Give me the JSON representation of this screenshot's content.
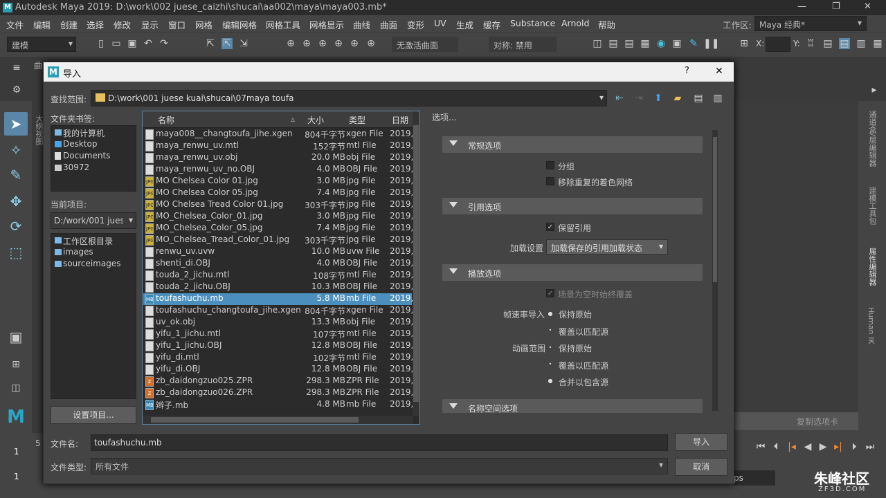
{
  "app": {
    "title": "Autodesk Maya 2019: D:\\work\\002 juese_caizhi\\shucai\\aa002\\maya\\maya003.mb*",
    "logo": "M",
    "menus": [
      "文件",
      "编辑",
      "创建",
      "选择",
      "修改",
      "显示",
      "窗口",
      "网格",
      "编辑网格",
      "网格工具",
      "网格显示",
      "曲线",
      "曲面",
      "变形",
      "UV",
      "生成",
      "缓存",
      "Substance",
      "Arnold",
      "帮助"
    ],
    "workspace_label": "工作区:",
    "workspace_value": "Maya 经典*",
    "mode_value": "建模",
    "live_surface": "无激活曲面",
    "symmetry": "对称: 禁用",
    "x_label": "X:",
    "y_label": "Y:",
    "shelf_tab": "曲",
    "right_tabs": [
      "通道盒/层编辑器",
      "建模工具包",
      "属性编辑器",
      "Human IK"
    ],
    "left_vertical": "大纲视图",
    "frame_start": "1",
    "frame_start2": "1",
    "frame_field": "5",
    "copy_tab": "复制选项卡",
    "fps_text": "ps",
    "watermark": "朱峰社区",
    "watermark_url": "ZF3D.COM"
  },
  "dialog": {
    "title": "导入",
    "help": "?",
    "close": "✕",
    "lookin_label": "查找范围:",
    "lookin_path": "D:\\work\\001 juese kuai\\shucai\\07maya toufa",
    "bookmarks_label": "文件夹书签:",
    "bookmarks": [
      "我的计算机",
      "Desktop",
      "Documents",
      "30972"
    ],
    "current_project_label": "当前项目:",
    "current_project": "D:/work/001 jues",
    "project_folders": [
      "工作区根目录",
      "images",
      "sourceimages"
    ],
    "set_project_button": "设置项目...",
    "columns": {
      "name": "名称",
      "size": "大小",
      "type": "类型",
      "date": "日期"
    },
    "files": [
      {
        "name": "maya008__changtoufa_jihe.xgen",
        "size": "804千字节",
        "type": "xgen File",
        "date": "2019,",
        "icon": "doc"
      },
      {
        "name": "maya_renwu_uv.mtl",
        "size": "152字节",
        "type": "mtl File",
        "date": "2019,",
        "icon": "doc"
      },
      {
        "name": "maya_renwu_uv.obj",
        "size": "20.0 MB",
        "type": "obj File",
        "date": "2019,",
        "icon": "doc"
      },
      {
        "name": "maya_renwu_uv_no.OBJ",
        "size": "4.0 MB",
        "type": "OBJ File",
        "date": "2019,",
        "icon": "doc"
      },
      {
        "name": "MO Chelsea Color 01.jpg",
        "size": "3.0 MB",
        "type": "jpg File",
        "date": "2019,",
        "icon": "jpg"
      },
      {
        "name": "MO Chelsea Color 05.jpg",
        "size": "7.4 MB",
        "type": "jpg File",
        "date": "2019,",
        "icon": "jpg"
      },
      {
        "name": "MO Chelsea Tread Color 01.jpg",
        "size": "303千字节",
        "type": "jpg File",
        "date": "2019,",
        "icon": "jpg"
      },
      {
        "name": "MO_Chelsea_Color_01.jpg",
        "size": "3.0 MB",
        "type": "jpg File",
        "date": "2019,",
        "icon": "jpg"
      },
      {
        "name": "MO_Chelsea_Color_05.jpg",
        "size": "7.4 MB",
        "type": "jpg File",
        "date": "2019,",
        "icon": "jpg"
      },
      {
        "name": "MO_Chelsea_Tread_Color_01.jpg",
        "size": "303千字节",
        "type": "jpg File",
        "date": "2019,",
        "icon": "jpg"
      },
      {
        "name": "renwu_uv.uvw",
        "size": "10.0 MB",
        "type": "uvw File",
        "date": "2019,",
        "icon": "doc"
      },
      {
        "name": "shenti_di.OBJ",
        "size": "4.0 MB",
        "type": "OBJ File",
        "date": "2019,",
        "icon": "doc"
      },
      {
        "name": "touda_2_jichu.mtl",
        "size": "108字节",
        "type": "mtl File",
        "date": "2019,",
        "icon": "doc"
      },
      {
        "name": "touda_2_jichu.OBJ",
        "size": "10.3 MB",
        "type": "OBJ File",
        "date": "2019,",
        "icon": "doc"
      },
      {
        "name": "toufashuchu.mb",
        "size": "5.8 MB",
        "type": "mb File",
        "date": "2019,",
        "icon": "mb",
        "selected": true
      },
      {
        "name": "toufashuchu_changtoufa_jihe.xgen",
        "size": "804千字节",
        "type": "xgen File",
        "date": "2019,",
        "icon": "doc"
      },
      {
        "name": "uv_ok.obj",
        "size": "13.3 MB",
        "type": "obj File",
        "date": "2019,",
        "icon": "doc"
      },
      {
        "name": "yifu_1_jichu.mtl",
        "size": "107字节",
        "type": "mtl File",
        "date": "2019,",
        "icon": "doc"
      },
      {
        "name": "yifu_1_jichu.OBJ",
        "size": "12.8 MB",
        "type": "OBJ File",
        "date": "2019,",
        "icon": "doc"
      },
      {
        "name": "yifu_di.mtl",
        "size": "102字节",
        "type": "mtl File",
        "date": "2019,",
        "icon": "doc"
      },
      {
        "name": "yifu_di.OBJ",
        "size": "12.8 MB",
        "type": "OBJ File",
        "date": "2019,",
        "icon": "doc"
      },
      {
        "name": "zb_daidongzuo025.ZPR",
        "size": "298.3 MB",
        "type": "ZPR File",
        "date": "2019,",
        "icon": "zpr"
      },
      {
        "name": "zb_daidongzuo026.ZPR",
        "size": "298.3 MB",
        "type": "ZPR File",
        "date": "2019,",
        "icon": "zpr"
      },
      {
        "name": "辫子.mb",
        "size": "4.8 MB",
        "type": "mb File",
        "date": "2019,",
        "icon": "mb"
      }
    ],
    "options_label": "选项...",
    "sections": {
      "general": "常规选项",
      "reference": "引用选项",
      "playback": "播放选项",
      "namespace": "名称空间选项"
    },
    "group_label": "分组",
    "remove_duplicate_label": "移除重复的着色网络",
    "keep_reference_label": "保留引用",
    "load_settings_label": "加载设置",
    "load_settings_value": "加载保存的引用加载状态",
    "scene_timeslider_label": "场景为空时始终覆盖",
    "framerate_import_label": "帧速率导入",
    "animation_range_label": "动画范围",
    "keep_original": "保持原始",
    "override_to_match": "覆盖以匹配源",
    "merge_to_include": "合并以包含源",
    "filename_label": "文件名:",
    "filename_value": "toufashuchu.mb",
    "filetype_label": "文件类型:",
    "filetype_value": "所有文件",
    "import_button": "导入",
    "cancel_button": "取消"
  }
}
